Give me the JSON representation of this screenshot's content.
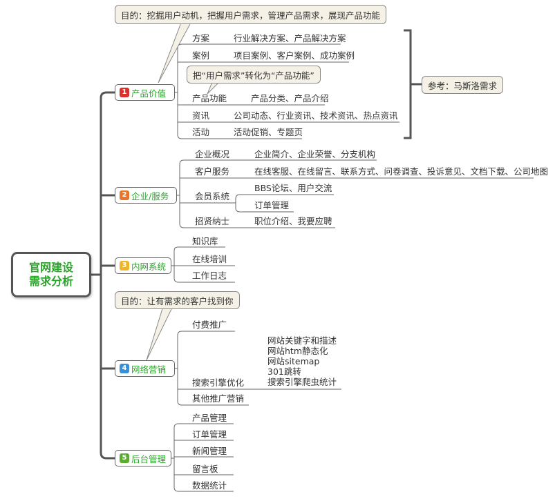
{
  "root": {
    "line1": "官网建设",
    "line2": "需求分析"
  },
  "colors": {
    "b1": "#d9302c",
    "b2": "#e8752a",
    "b3": "#f0b428",
    "b4": "#3b8fd4",
    "b5": "#5cab32"
  },
  "branches": [
    {
      "num": "1",
      "label": "产品价值"
    },
    {
      "num": "2",
      "label": "企业/服务"
    },
    {
      "num": "3",
      "label": "内网系统"
    },
    {
      "num": "4",
      "label": "网络营销"
    },
    {
      "num": "5",
      "label": "后台管理"
    }
  ],
  "callouts": {
    "purpose1": "目的：挖掘用户动机，把握用户需求，管理产品需求，展现产品功能",
    "convert": "把“用户需求”转化为“产品功能”",
    "reference": "参考：马斯洛需求",
    "purpose4": "目的：让有需求的客户找到你"
  },
  "b1": {
    "items": [
      {
        "label": "方案",
        "detail": "行业解决方案、产品解决方案"
      },
      {
        "label": "案例",
        "detail": "项目案例、客户案例、成功案例"
      },
      {
        "label": "产品功能",
        "detail": "产品分类、产品介绍"
      },
      {
        "label": "资讯",
        "detail": "公司动态、行业资讯、技术资讯、热点资讯"
      },
      {
        "label": "活动",
        "detail": "活动促销、专题页"
      }
    ]
  },
  "b2": {
    "items": [
      {
        "label": "企业概况",
        "detail": "企业简介、企业荣誉、分支机构"
      },
      {
        "label": "客户服务",
        "detail": "在线客服、在线留言、联系方式、问卷调查、投诉意见、文档下载、公司地图"
      },
      {
        "label": "会员系统",
        "detail": "BBS论坛、用户交流",
        "detail2": "订单管理"
      },
      {
        "label": "招贤纳士",
        "detail": "职位介绍、我要应聘"
      }
    ]
  },
  "b3": {
    "items": [
      "知识库",
      "在线培训",
      "工作日志"
    ]
  },
  "b4": {
    "items": [
      "付费推广",
      "搜索引擎优化",
      "其他推广营销"
    ],
    "seo": [
      "网站关键字和描述",
      "网站htm静态化",
      "网站sitemap",
      "301跳转",
      "搜索引擎爬虫统计"
    ]
  },
  "b5": {
    "items": [
      "产品管理",
      "订单管理",
      "新闻管理",
      "留言板",
      "数据统计"
    ]
  }
}
